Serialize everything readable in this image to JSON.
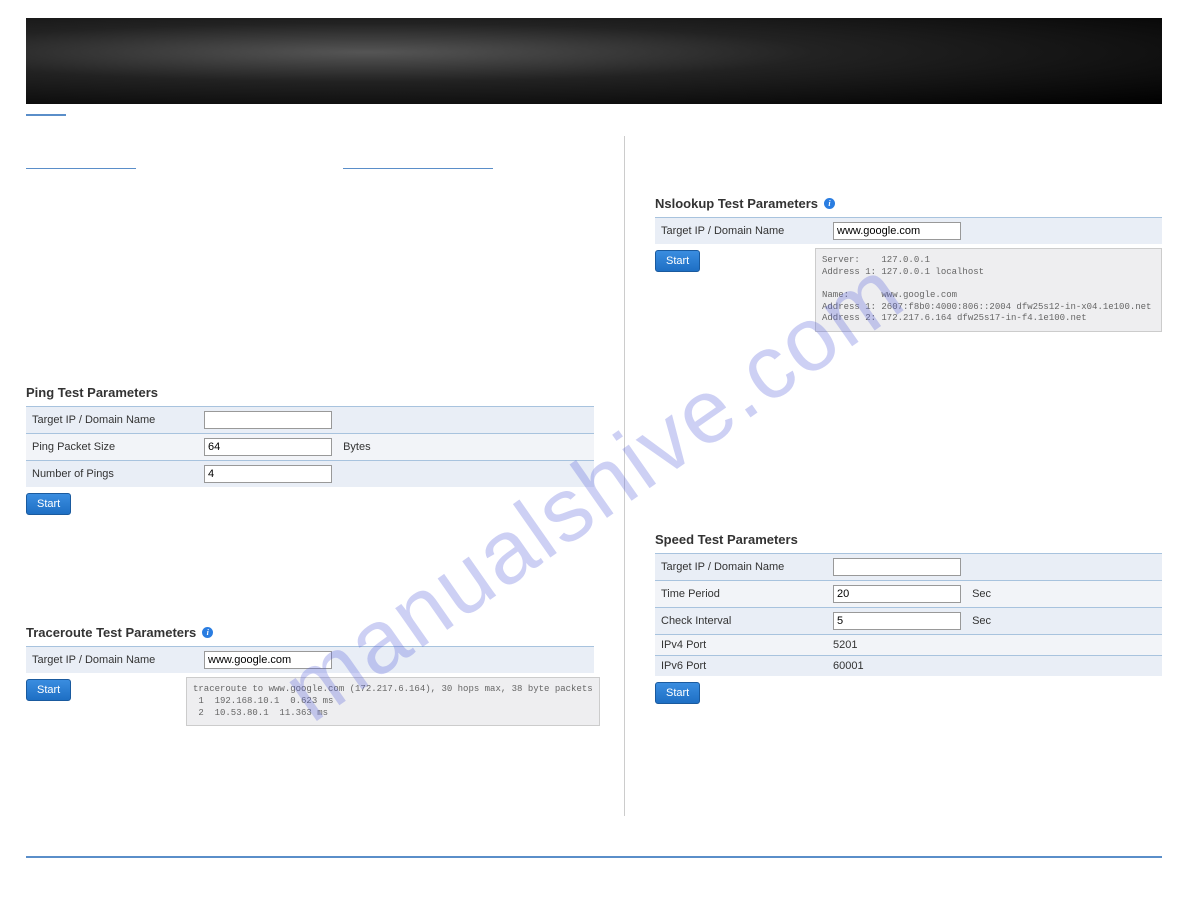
{
  "watermark": "manualshive.com",
  "left": {
    "link_placeholder_1_width": 110,
    "link_placeholder_2_width": 150,
    "ping": {
      "title": "Ping Test Parameters",
      "rows": {
        "target_label": "Target IP / Domain Name",
        "target_value": "",
        "size_label": "Ping Packet Size",
        "size_value": "64",
        "size_unit": "Bytes",
        "count_label": "Number of Pings",
        "count_value": "4"
      },
      "start": "Start"
    },
    "traceroute": {
      "title": "Traceroute Test Parameters",
      "target_label": "Target IP / Domain Name",
      "target_value": "www.google.com",
      "start": "Start",
      "output": "traceroute to www.google.com (172.217.6.164), 30 hops max, 38 byte packets\n 1  192.168.10.1  0.623 ms\n 2  10.53.80.1  11.363 ms"
    }
  },
  "right": {
    "nslookup": {
      "title": "Nslookup Test Parameters",
      "target_label": "Target IP / Domain Name",
      "target_value": "www.google.com",
      "start": "Start",
      "output": "Server:    127.0.0.1\nAddress 1: 127.0.0.1 localhost\n\nName:      www.google.com\nAddress 1: 2607:f8b0:4000:806::2004 dfw25s12-in-x04.1e100.net\nAddress 2: 172.217.6.164 dfw25s17-in-f4.1e100.net"
    },
    "speed": {
      "title": "Speed Test Parameters",
      "target_label": "Target IP / Domain Name",
      "target_value": "",
      "time_label": "Time Period",
      "time_value": "20",
      "time_unit": "Sec",
      "interval_label": "Check Interval",
      "interval_value": "5",
      "interval_unit": "Sec",
      "ipv4_label": "IPv4 Port",
      "ipv4_value": "5201",
      "ipv6_label": "IPv6 Port",
      "ipv6_value": "60001",
      "start": "Start"
    }
  }
}
